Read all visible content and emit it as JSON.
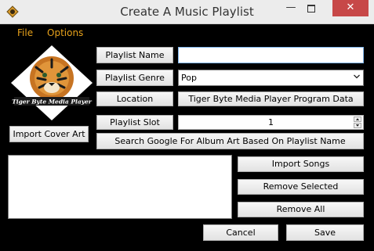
{
  "window": {
    "title": "Create A Music Playlist",
    "minimize_glyph": "—",
    "close_glyph": "✕"
  },
  "menu": {
    "file": "File",
    "options": "Options"
  },
  "logo": {
    "caption": "Tiger Byte Media Player",
    "colors": {
      "background": "#ffffff",
      "band": "#1a1a1a",
      "accent": "#e8a21b"
    }
  },
  "form": {
    "playlist_name_label": "Playlist Name",
    "playlist_name_value": "",
    "playlist_genre_label": "Playlist Genre",
    "playlist_genre_value": "Pop",
    "location_label": "Location",
    "location_value": "Tiger Byte Media Player Program Data",
    "playlist_slot_label": "Playlist Slot",
    "playlist_slot_value": "1",
    "import_cover_art": "Import Cover Art",
    "search_google": "Search Google For Album Art Based On Playlist Name"
  },
  "songs": {
    "import_songs": "Import Songs",
    "remove_selected": "Remove Selected",
    "remove_all": "Remove All"
  },
  "footer": {
    "cancel": "Cancel",
    "save": "Save"
  },
  "colors": {
    "window_bg": "#000000",
    "menu_text": "#e8a21b",
    "close_button": "#c74848",
    "focus_border": "#7eb4ea"
  }
}
